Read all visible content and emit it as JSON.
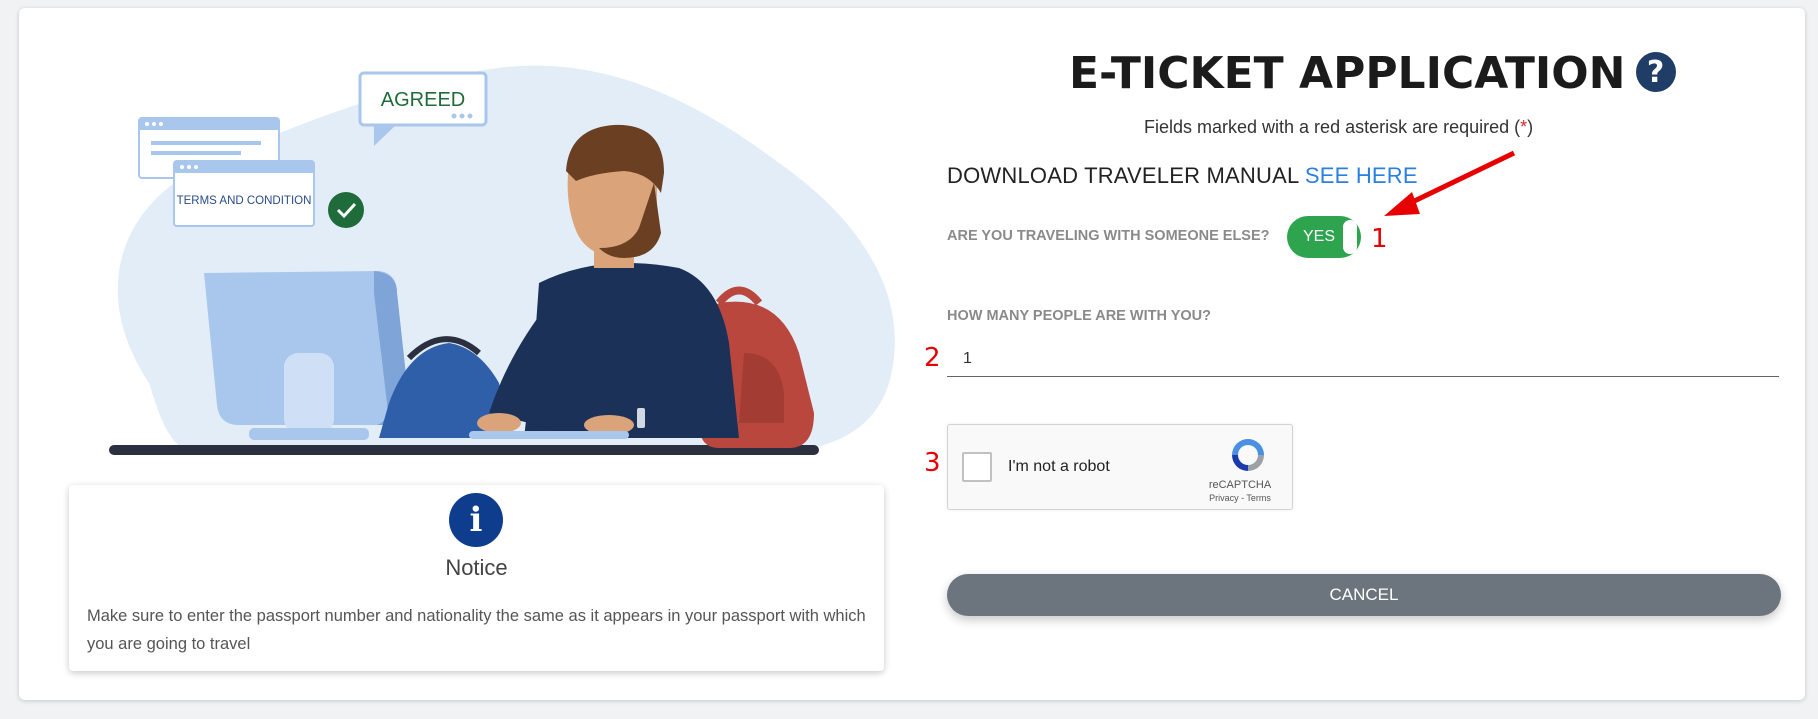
{
  "illustration": {
    "bubble_text": "AGREED",
    "terms_text": "TERMS AND CONDITION"
  },
  "notice": {
    "icon": "info-icon",
    "title": "Notice",
    "text": "Make sure to enter the passport number and nationality the same as it appears in your passport with which you are going to travel"
  },
  "form": {
    "title": "E-TICKET APPLICATION",
    "help_icon": "?",
    "subtitle_prefix": "Fields marked with a red asterisk are required (",
    "subtitle_asterisk": "*",
    "subtitle_suffix": ")",
    "manual_text": "DOWNLOAD TRAVELER MANUAL",
    "manual_link": "SEE HERE",
    "traveling_question": "ARE YOU TRAVELING WITH SOMEONE ELSE?",
    "toggle_label": "YES",
    "people_question": "HOW MANY PEOPLE ARE WITH YOU?",
    "people_value": "1",
    "captcha_label": "I'm not a robot",
    "captcha_brand": "reCAPTCHA",
    "captcha_terms": "Privacy - Terms",
    "cancel_label": "CANCEL"
  },
  "annotations": {
    "n1": "1",
    "n2": "2",
    "n3": "3"
  },
  "colors": {
    "toggle_on": "#2ea44f",
    "cancel_button": "#6c757d",
    "link": "#2b7fe0",
    "annotation": "#e60000",
    "asterisk": "#d6262b"
  }
}
